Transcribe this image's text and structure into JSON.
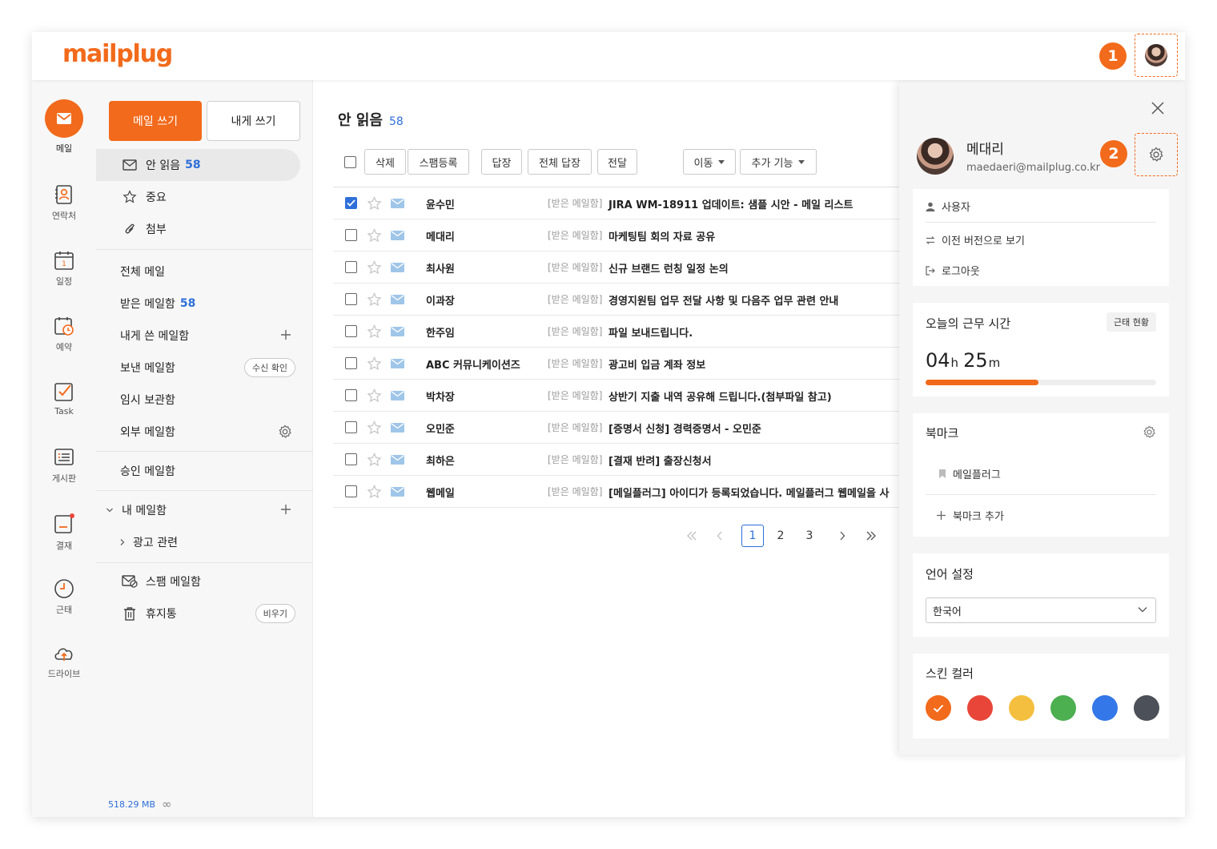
{
  "header": {
    "logo": "mailplug",
    "badge1": "1",
    "badge2": "2"
  },
  "rail": [
    {
      "label": "메일",
      "icon": "mail-icon"
    },
    {
      "label": "연락처",
      "icon": "contact-icon"
    },
    {
      "label": "일정",
      "icon": "calendar-icon"
    },
    {
      "label": "예약",
      "icon": "reservation-icon"
    },
    {
      "label": "Task",
      "icon": "task-icon"
    },
    {
      "label": "게시판",
      "icon": "board-icon"
    },
    {
      "label": "결재",
      "icon": "approval-icon"
    },
    {
      "label": "근태",
      "icon": "clock-icon"
    },
    {
      "label": "드라이브",
      "icon": "cloud-icon"
    }
  ],
  "folders": {
    "write_label": "메일 쓰기",
    "self_label": "내게 쓰기",
    "unread": {
      "label": "안 읽음",
      "count": "58"
    },
    "important": "중요",
    "attach": "첨부",
    "all": "전체 메일",
    "inbox": {
      "label": "받은 메일함",
      "count": "58"
    },
    "self_box": "내게 쓴 메일함",
    "sent": "보낸 메일함",
    "sent_pill": "수신 확인",
    "drafts": "임시 보관함",
    "external": "외부 메일함",
    "approval": "승인 메일함",
    "my_boxes": "내 메일함",
    "ad": "광고 관련",
    "spam": "스팸 메일함",
    "trash": "휴지통",
    "trash_pill": "비우기",
    "storage": "518.29 MB",
    "storage_limit": "∞"
  },
  "list": {
    "title": "안 읽음",
    "count": "58",
    "toolbar": {
      "delete": "삭제",
      "spam": "스팸등록",
      "reply": "답장",
      "reply_all": "전체 답장",
      "forward": "전달",
      "move": "이동",
      "more": "추가 기능"
    },
    "rows": [
      {
        "sender": "윤수민",
        "folder": "[받은 메일함]",
        "subject": "JIRA WM-18911 업데이트: 샘플 시안 - 메일 리스트",
        "checked": true
      },
      {
        "sender": "메대리",
        "folder": "[받은 메일함]",
        "subject": "마케팅팀 회의 자료 공유",
        "checked": false
      },
      {
        "sender": "최사원",
        "folder": "[받은 메일함]",
        "subject": "신규 브랜드 런칭 일정 논의",
        "checked": false
      },
      {
        "sender": "이과장",
        "folder": "[받은 메일함]",
        "subject": "경영지원팀 업무 전달 사항 및 다음주 업무 관련 안내",
        "checked": false
      },
      {
        "sender": "한주임",
        "folder": "[받은 메일함]",
        "subject": "파일 보내드립니다.",
        "checked": false
      },
      {
        "sender": "ABC 커뮤니케이션즈",
        "folder": "[받은 메일함]",
        "subject": "광고비 입금 계좌 정보",
        "checked": false
      },
      {
        "sender": "박차장",
        "folder": "[받은 메일함]",
        "subject": "상반기 지출 내역 공유해 드립니다.(첨부파일 참고)",
        "checked": false
      },
      {
        "sender": "오민준",
        "folder": "[받은 메일함]",
        "subject": "[증명서 신청] 경력증명서 - 오민준",
        "checked": false
      },
      {
        "sender": "최하은",
        "folder": "[받은 메일함]",
        "subject": "[결재 반려] 출장신청서",
        "checked": false
      },
      {
        "sender": "웹메일",
        "folder": "[받은 메일함]",
        "subject": "[메일플러그] 아이디가 등록되었습니다. 메일플러그 웹메일을 사",
        "checked": false
      }
    ],
    "pages": [
      "1",
      "2",
      "3"
    ],
    "current_page": "1"
  },
  "panel": {
    "user_name": "메대리",
    "user_email": "maedaeri@mailplug.co.kr",
    "menu_user": "사용자",
    "menu_prev": "이전 버전으로 보기",
    "menu_logout": "로그아웃",
    "work_title": "오늘의 근무 시간",
    "work_badge": "근태 현황",
    "work_hours": "04",
    "work_h_unit": "h",
    "work_minutes": "25",
    "work_m_unit": "m",
    "work_progress": 0.49,
    "bookmark_title": "북마크",
    "bookmark_item": "메일플러그",
    "bookmark_add": "북마크 추가",
    "lang_title": "언어 설정",
    "lang_value": "한국어",
    "skin_title": "스킨 컬러",
    "skins": [
      "#f26a1b",
      "#e9463a",
      "#f4bf3f",
      "#4caf50",
      "#3377e8",
      "#4c5058"
    ],
    "accent": "#f26a1b",
    "link_color": "#2e6fd9"
  }
}
